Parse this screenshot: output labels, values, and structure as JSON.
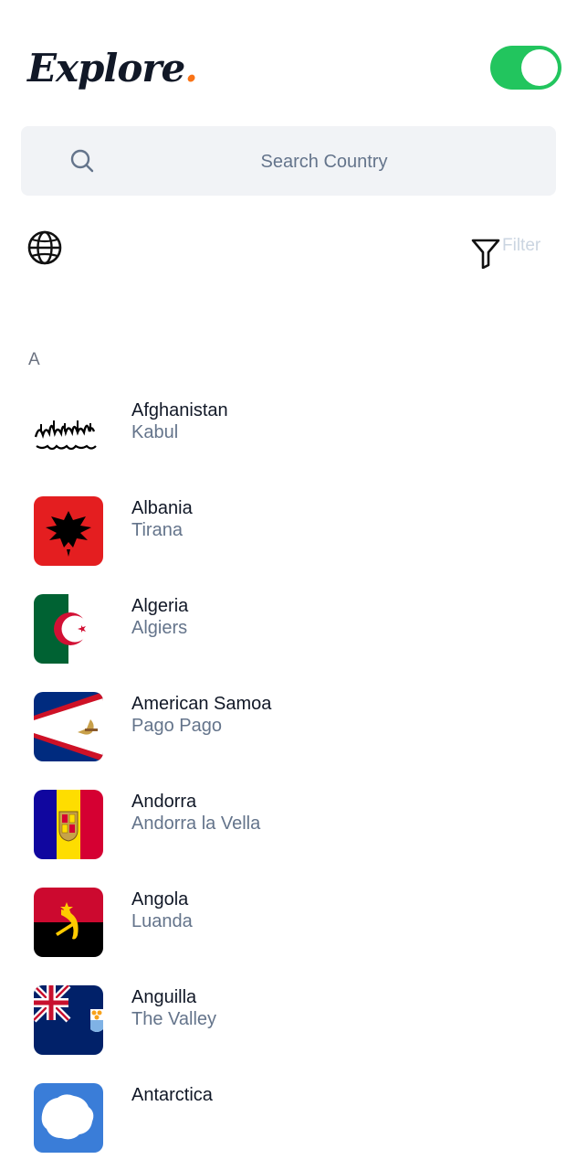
{
  "header": {
    "title": "Explore",
    "title_dot": ".",
    "dark_mode_toggle": true
  },
  "search": {
    "placeholder": "Search Country",
    "icon": "search-icon"
  },
  "toolbar": {
    "globe_icon": "globe-icon",
    "filter_label": "Filter",
    "filter_icon": "filter-icon"
  },
  "section": {
    "letter": "A"
  },
  "countries": [
    {
      "name": "Afghanistan",
      "capital": "Kabul"
    },
    {
      "name": "Albania",
      "capital": "Tirana"
    },
    {
      "name": "Algeria",
      "capital": "Algiers"
    },
    {
      "name": "American Samoa",
      "capital": "Pago Pago"
    },
    {
      "name": "Andorra",
      "capital": "Andorra la Vella"
    },
    {
      "name": "Angola",
      "capital": "Luanda"
    },
    {
      "name": "Anguilla",
      "capital": "The Valley"
    },
    {
      "name": "Antarctica",
      "capital": ""
    }
  ],
  "colors": {
    "accent_green": "#22c55e",
    "logo_dot": "#f97316",
    "search_bg": "#f1f3f6",
    "muted_text": "#64748b"
  }
}
